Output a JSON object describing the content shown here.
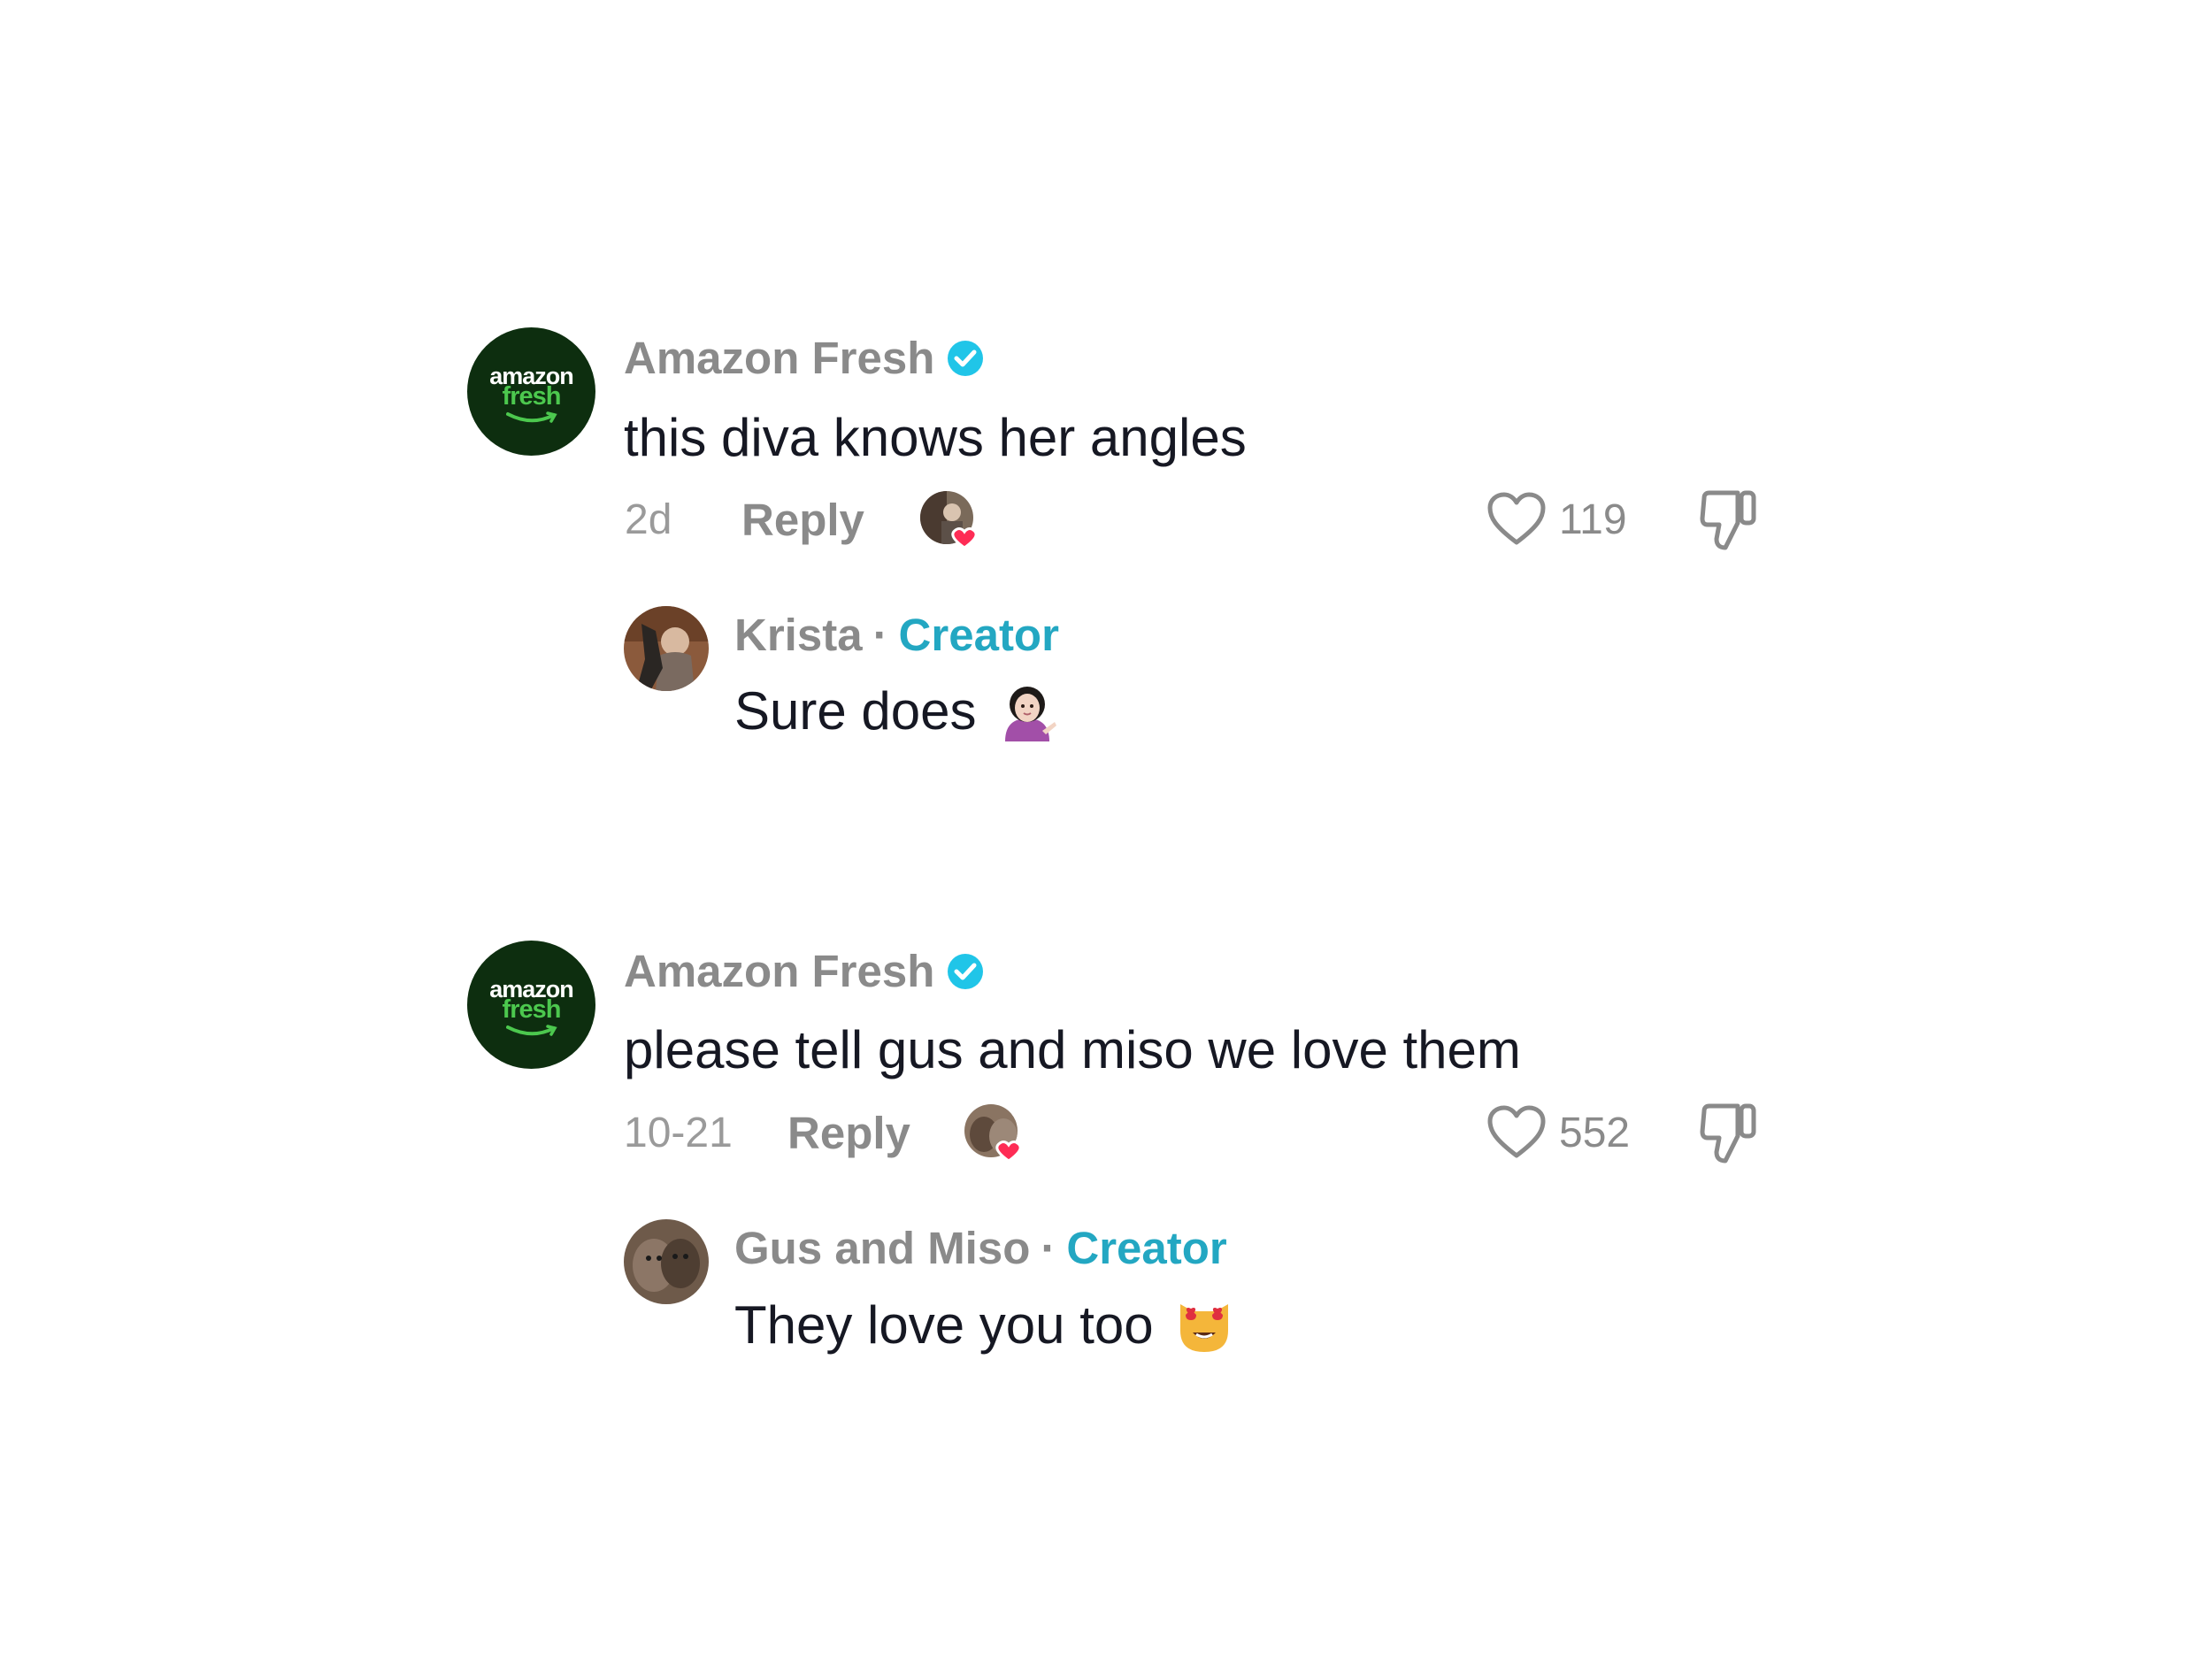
{
  "threads": [
    {
      "comment": {
        "avatar_text": [
          "amazon",
          "fresh"
        ],
        "author": "Amazon Fresh",
        "verified": true,
        "text": "this diva knows her angles",
        "time": "2d",
        "reply_label": "Reply",
        "likes": "119"
      },
      "reply": {
        "author": "Krista",
        "separator": "·",
        "badge": "Creator",
        "text": "Sure does",
        "emoji": "woman-tipping-hand-emoji"
      }
    },
    {
      "comment": {
        "avatar_text": [
          "amazon",
          "fresh"
        ],
        "author": "Amazon Fresh",
        "verified": true,
        "text": "please tell gus and miso we love them",
        "time": "10-21",
        "reply_label": "Reply",
        "likes": "552"
      },
      "reply": {
        "author": "Gus and Miso",
        "separator": "·",
        "badge": "Creator",
        "text": "They love you too",
        "emoji": "heart-eyes-cat-emoji"
      }
    }
  ],
  "colors": {
    "brand_avatar_bg": "#0d2e0f",
    "brand_green": "#4cc84e",
    "verified_blue": "#20c5e8",
    "creator_blue": "#23a7c2",
    "heart_red": "#fe2c55",
    "muted_text": "#8a8a8a"
  }
}
